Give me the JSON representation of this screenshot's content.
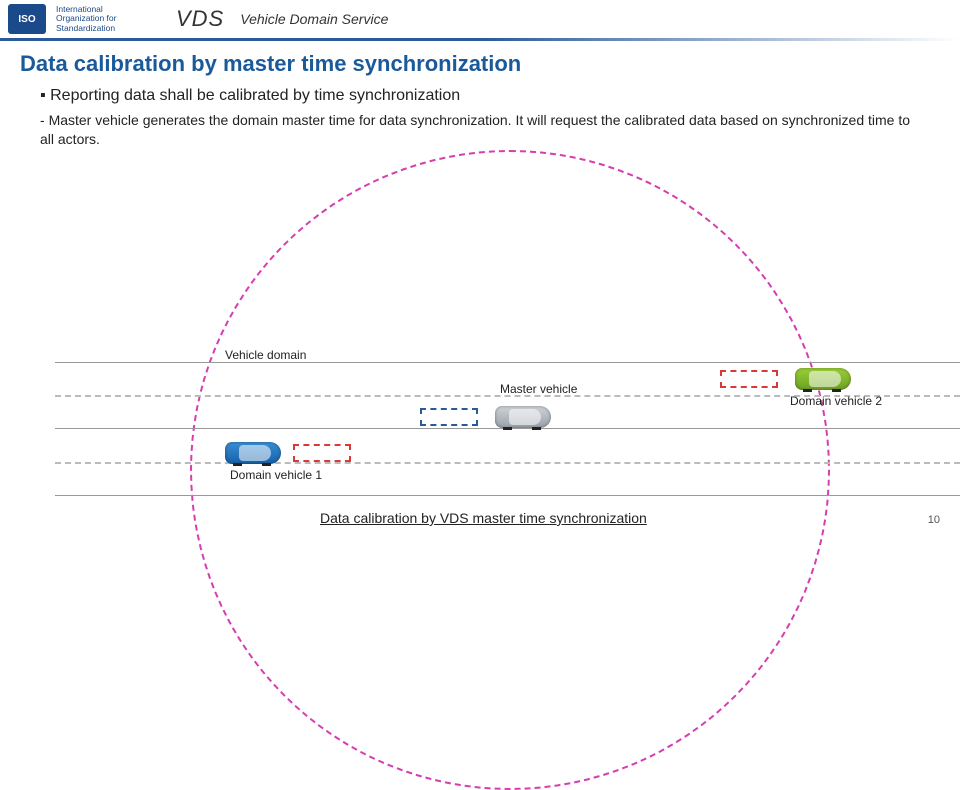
{
  "header": {
    "iso_abbr": "ISO",
    "iso_line1": "International",
    "iso_line2": "Organization for",
    "iso_line3": "Standardization",
    "vds": "VDS",
    "vds_full": "Vehicle Domain Service"
  },
  "title": "Data calibration by master time synchronization",
  "bullet": "Reporting data shall be calibrated by time synchronization",
  "sub": "Master vehicle generates the domain master time for data synchronization. It will request the calibrated data based on synchronized time to all actors.",
  "labels": {
    "vehicle_domain": "Vehicle domain",
    "master_vehicle": "Master vehicle",
    "domain_vehicle_1": "Domain vehicle 1",
    "domain_vehicle_2": "Domain vehicle 2"
  },
  "caption": "Data calibration by VDS master time synchronization",
  "page": "10"
}
